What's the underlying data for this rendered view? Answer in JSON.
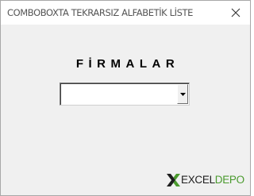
{
  "window": {
    "title": "COMBOBOXTA TEKRARSIZ ALFABETİK LİSTE",
    "close_icon": "close-icon"
  },
  "form": {
    "heading": "FİRMALAR",
    "combobox": {
      "value": "",
      "arrow_icon": "dropdown-arrow-icon"
    }
  },
  "logo": {
    "mark": "x-logo-mark",
    "excel_text": "EXCEL",
    "depo_text": "DEPO"
  },
  "colors": {
    "titlebar": "#ffffff",
    "client_background": "#f0f0f0",
    "logo_green": "#4a9a2e",
    "logo_dark": "#1f1f1f"
  }
}
